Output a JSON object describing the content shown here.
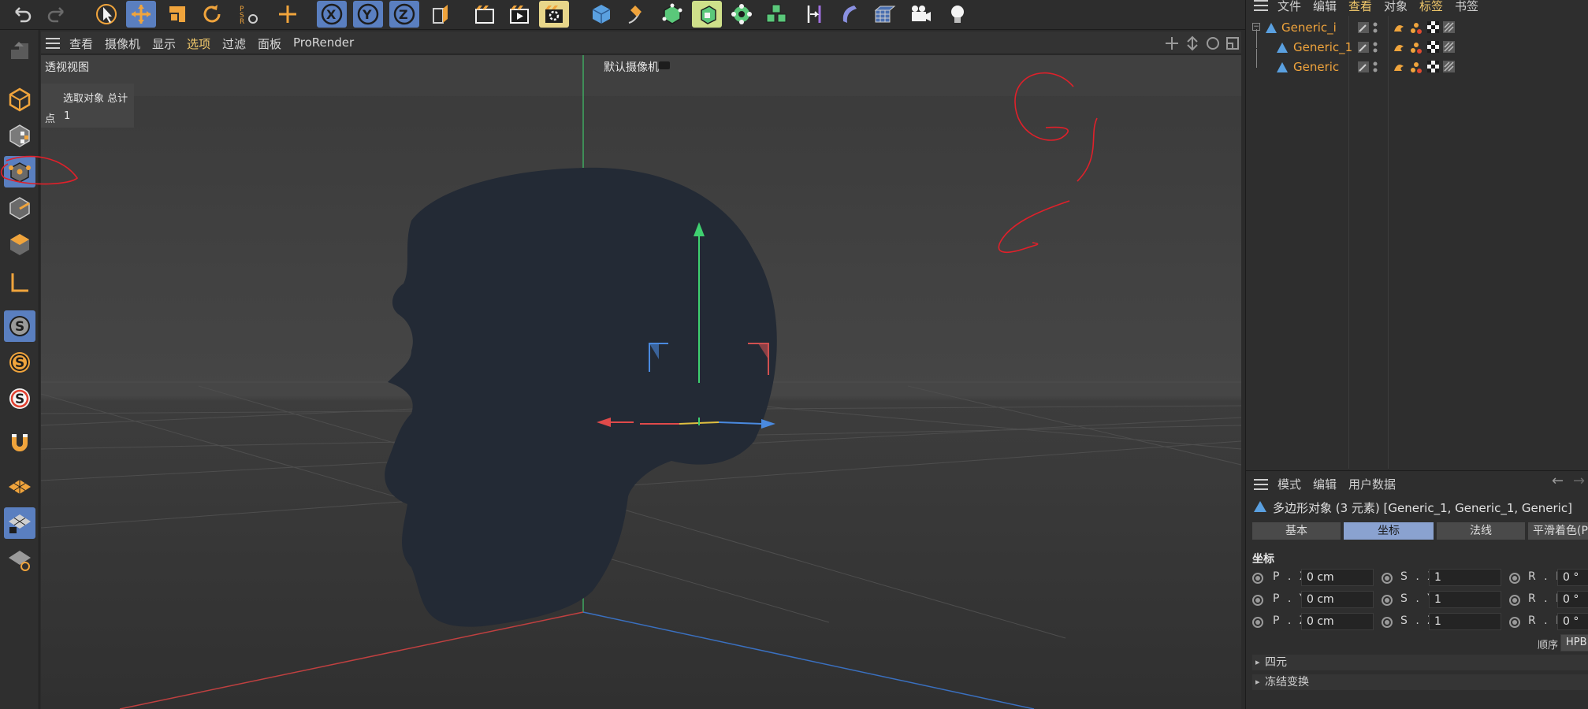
{
  "viewport_menu": {
    "items": [
      "查看",
      "摄像机",
      "显示",
      "选项",
      "过滤",
      "面板",
      "ProRender"
    ],
    "highlighted": "选项"
  },
  "viewport": {
    "name": "透视视图",
    "camera": "默认摄像机",
    "hud": {
      "header": "选取对象 总计",
      "row_label": "点",
      "row_value": "1"
    }
  },
  "object_manager": {
    "menu": [
      "文件",
      "编辑",
      "查看",
      "对象",
      "标签",
      "书签"
    ],
    "highlighted": [
      "查看",
      "标签"
    ],
    "objects": [
      {
        "name": "Generic_i",
        "level": 0
      },
      {
        "name": "Generic_1",
        "level": 1
      },
      {
        "name": "Generic",
        "level": 1
      }
    ]
  },
  "attributes": {
    "menu": [
      "模式",
      "编辑",
      "用户数据"
    ],
    "title": "多边形对象 (3 元素) [Generic_1, Generic_1, Generic]",
    "tabs": [
      "基本",
      "坐标",
      "法线",
      "平滑着色(Ph"
    ],
    "active_tab": "坐标",
    "section_title": "坐标",
    "rows": [
      {
        "p_label": "P . X",
        "p_value": "0 cm",
        "s_label": "S . X",
        "s_value": "1",
        "r_label": "R . H",
        "r_value": "0 °"
      },
      {
        "p_label": "P . Y",
        "p_value": "0 cm",
        "s_label": "S . Y",
        "s_value": "1",
        "r_label": "R . P",
        "r_value": "0 °"
      },
      {
        "p_label": "P . Z",
        "p_value": "0 cm",
        "s_label": "S . Z",
        "s_value": "1",
        "r_label": "R . B",
        "r_value": "0 °"
      }
    ],
    "order_label": "顺序",
    "order_value": "HPB",
    "collapsed_sections": [
      "四元",
      "冻结变换"
    ]
  },
  "colors": {
    "accent": "#5a7fc0",
    "object_name": "#f0a43c",
    "annotation": "#e0202a",
    "skull": "#232a35"
  }
}
